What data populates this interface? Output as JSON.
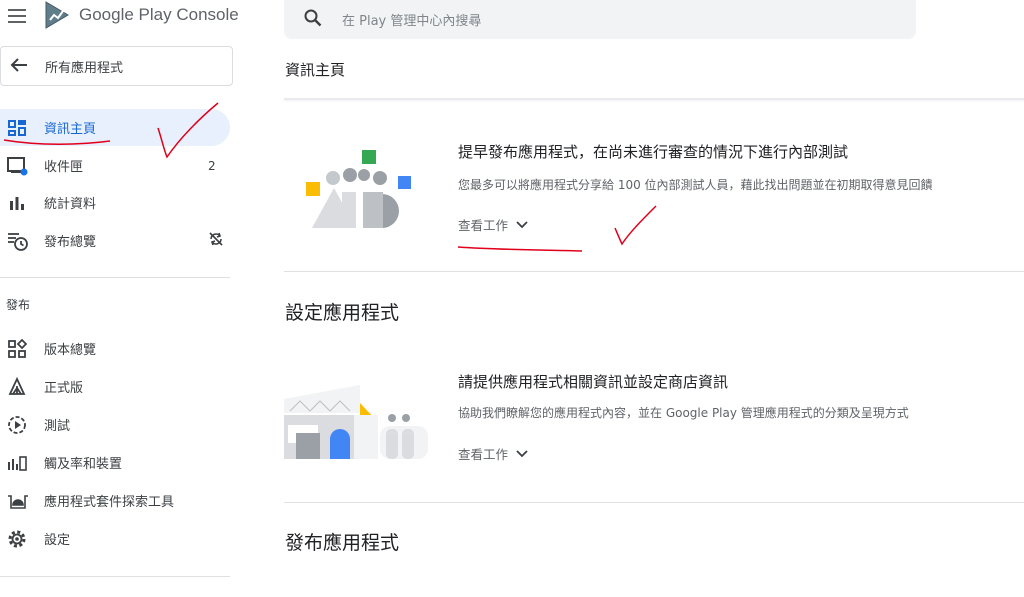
{
  "app": {
    "brand": "Google Play Console"
  },
  "sidebar": {
    "back_label": "所有應用程式",
    "items": [
      {
        "label": "資訊主頁",
        "icon": "dashboard-icon",
        "active": true
      },
      {
        "label": "收件匣",
        "icon": "inbox-icon",
        "badge": "2"
      },
      {
        "label": "統計資料",
        "icon": "bar-chart-icon"
      },
      {
        "label": "發布總覽",
        "icon": "publishing-overview-icon",
        "tail_icon": "sync-disabled-icon"
      }
    ],
    "release_section": {
      "label": "發布",
      "items": [
        {
          "label": "版本總覽",
          "icon": "releases-overview-icon"
        },
        {
          "label": "正式版",
          "icon": "production-icon"
        },
        {
          "label": "測試",
          "icon": "testing-icon"
        },
        {
          "label": "觸及率和裝置",
          "icon": "reach-devices-icon"
        },
        {
          "label": "應用程式套件探索工具",
          "icon": "android-bundle-icon"
        },
        {
          "label": "設定",
          "icon": "settings-gear-icon"
        }
      ]
    }
  },
  "search": {
    "placeholder": "在 Play 管理中心內搜尋"
  },
  "main": {
    "page_title": "資訊主頁",
    "cards": [
      {
        "title": "提早發布應用程式，在尚未進行審查的情況下進行內部測試",
        "description": "您最多可以將應用程式分享給 100 位內部測試人員，藉此找出問題並在初期取得意見回饋",
        "action_label": "查看工作"
      }
    ],
    "sections": [
      {
        "title": "設定應用程式",
        "card": {
          "title": "請提供應用程式相關資訊並設定商店資訊",
          "description": "協助我們瞭解您的應用程式內容，並在 Google Play 管理應用程式的分類及呈現方式",
          "action_label": "查看工作"
        }
      },
      {
        "title": "發布應用程式"
      }
    ]
  },
  "colors": {
    "active_bg": "#e8f0fe",
    "active_text": "#1967d2",
    "annotation_red": "#e0001b",
    "google_green": "#34a853",
    "google_blue": "#4285f4",
    "google_yellow": "#fbbc04"
  }
}
